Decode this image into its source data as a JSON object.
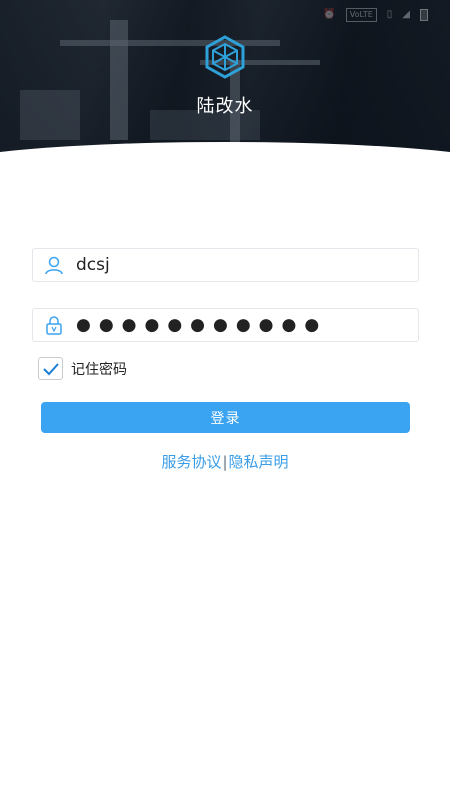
{
  "header": {
    "app_name": "陆改水",
    "logo_icon": "cube-logo-icon",
    "status_bar": {
      "network_badge": "VoLTE"
    }
  },
  "login": {
    "username": {
      "value": "dcsj",
      "icon": "user-icon"
    },
    "password": {
      "masked_value": "●●●●●●●●●●●",
      "icon": "lock-icon"
    },
    "remember": {
      "label": "记住密码",
      "checked": true
    },
    "submit_label": "登录",
    "links": {
      "service_agreement": "服务协议",
      "separator": "|",
      "privacy_statement": "隐私声明"
    }
  },
  "colors": {
    "accent": "#3aa3f2",
    "link": "#3a9de8",
    "logo": "#2ea1d9"
  }
}
